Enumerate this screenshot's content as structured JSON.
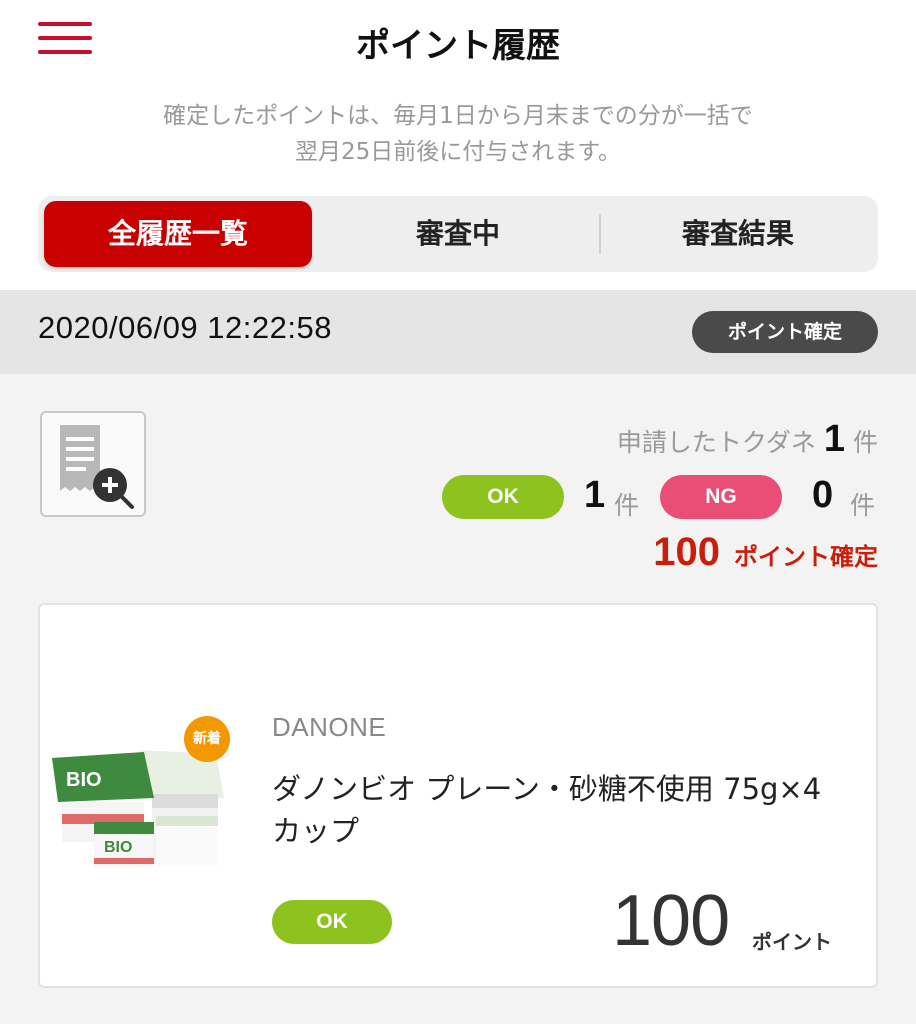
{
  "header": {
    "title": "ポイント履歴",
    "menu_icon": "hamburger-menu-icon"
  },
  "notice": {
    "line1": "確定したポイントは、毎月1日から月末までの分が一括で",
    "line2": "翌月25日前後に付与されます。"
  },
  "tabs": [
    {
      "label": "全履歴一覧",
      "active": true
    },
    {
      "label": "審査中",
      "active": false
    },
    {
      "label": "審査結果",
      "active": false
    }
  ],
  "entry": {
    "datetime": "2020/06/09 12:22:58",
    "status": "ポイント確定",
    "receipt_icon": "receipt-zoom-icon",
    "applied_label": "申請したトクダネ",
    "applied_count": "1",
    "unit": "件",
    "ok_label": "OK",
    "ok_count": "1",
    "ng_label": "NG",
    "ng_count": "0",
    "total_points": "100",
    "total_points_label": "ポイント確定"
  },
  "product": {
    "new_badge": "新着",
    "brand": "DANONE",
    "name": "ダノンビオ プレーン・砂糖不使用 75g×4カップ",
    "status": "OK",
    "points": "100",
    "points_unit": "ポイント",
    "image_label": "BIO"
  },
  "colors": {
    "accent_red": "#c80000",
    "ok_green": "#8dc21f",
    "ng_pink": "#e94e77",
    "badge_orange": "#f39800"
  }
}
